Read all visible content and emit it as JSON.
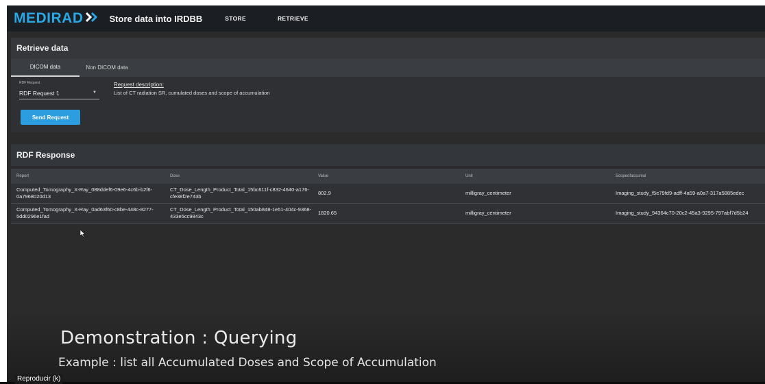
{
  "header": {
    "logo_part1": "MEDI",
    "logo_part2": "RAD",
    "title": "Store data into IRDBB",
    "nav": [
      {
        "label": "STORE"
      },
      {
        "label": "RETRIEVE"
      }
    ]
  },
  "retrieve": {
    "title": "Retrieve data",
    "tabs": [
      {
        "label": "DICOM data",
        "active": true
      },
      {
        "label": "Non DICOM data",
        "active": false
      }
    ],
    "rdf_request_label": "RDF Request",
    "rdf_request_value": "RDF Request 1",
    "request_description_label": "Request description:",
    "request_description_text": "List of CT radiation SR, cumulated doses and scope of accumulation",
    "send_button": "Send Request"
  },
  "response": {
    "title": "RDF Response",
    "columns": [
      "Report",
      "Dose",
      "Value",
      "Unit",
      "Scopeofaccumul"
    ],
    "rows": [
      {
        "report": "Computed_Tomography_X-Ray_088ddef6-09e6-4c6b-b2f6-0a7968020d13",
        "dose": "CT_Dose_Length_Product_Total_15bc611f-c832-4640-a176-cfe38f2e743b",
        "value": "802.9",
        "unit": "milligray_centimeter",
        "scope": "Imaging_study_f5e79fd9-adff-4a59-a0a7-317a5885edec"
      },
      {
        "report": "Computed_Tomography_X-Ray_0ad63f60-c8be-448c-8277-5dd0296e1fad",
        "dose": "CT_Dose_Length_Product_Total_150ab848-1e51-404c-9368-433e5cc9843c",
        "value": "1820.65",
        "unit": "milligray_centimeter",
        "scope": "Imaging_study_94364c70-20c2-45a3-9295-797abf7d5b24"
      }
    ]
  },
  "caption": {
    "title": "Demonstration : Querying",
    "subtitle": "Example : list all Accumulated Doses and Scope of Accumulation"
  },
  "player": {
    "play_hint": "Reproducir (k)"
  },
  "colors": {
    "accent": "#2c9ee0",
    "header_bg": "#1b1e22",
    "panel_bg": "#2e3033"
  }
}
